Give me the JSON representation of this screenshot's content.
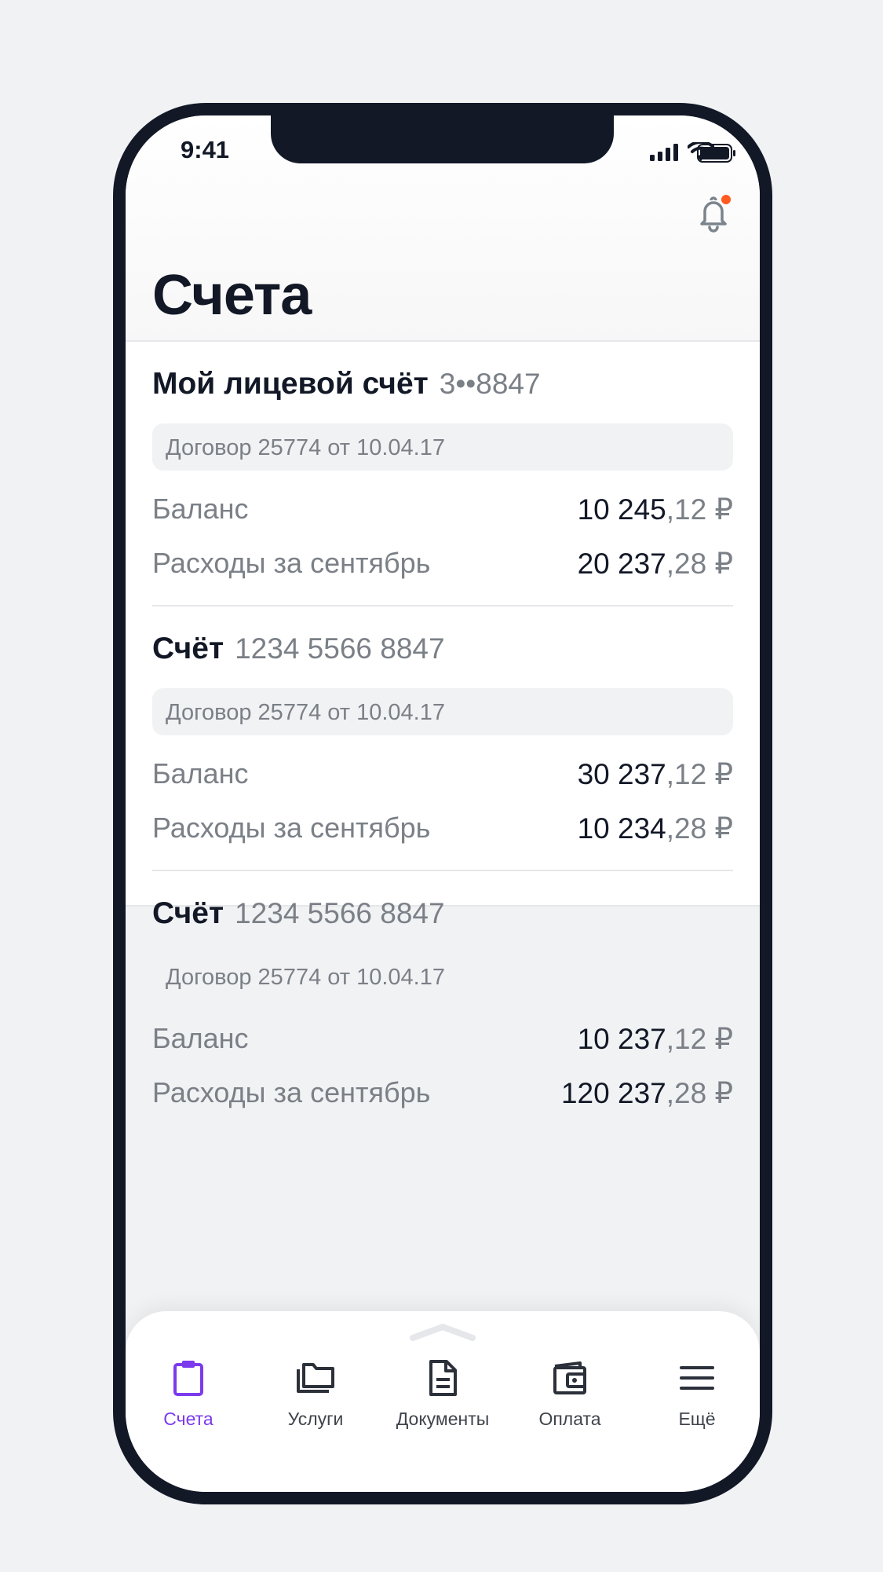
{
  "status_bar": {
    "time": "9:41"
  },
  "header": {
    "title": "Счета"
  },
  "accounts": [
    {
      "name": "Мой лицевой счёт",
      "number": "3••8847",
      "contract": "Договор 25774 от 10.04.17",
      "balance_label": "Баланс",
      "balance_int": "10 245",
      "balance_frac": ",12 ₽",
      "expenses_label": "Расходы за сентябрь",
      "expenses_int": "20 237",
      "expenses_frac": ",28 ₽"
    },
    {
      "name": "Счёт",
      "number": "1234 5566 8847",
      "contract": "Договор 25774 от 10.04.17",
      "balance_label": "Баланс",
      "balance_int": "30 237",
      "balance_frac": ",12 ₽",
      "expenses_label": "Расходы за сентябрь",
      "expenses_int": "10 234",
      "expenses_frac": ",28 ₽"
    },
    {
      "name": "Счёт",
      "number": "1234 5566 8847",
      "contract": "Договор 25774 от 10.04.17",
      "balance_label": "Баланс",
      "balance_int": "10 237",
      "balance_frac": ",12 ₽",
      "expenses_label": "Расходы за сентябрь",
      "expenses_int": "120 237",
      "expenses_frac": ",28 ₽"
    }
  ],
  "tabbar": {
    "items": [
      {
        "label": "Счета",
        "icon": "clipboard-icon",
        "active": true
      },
      {
        "label": "Услуги",
        "icon": "folders-icon",
        "active": false
      },
      {
        "label": "Документы",
        "icon": "document-icon",
        "active": false
      },
      {
        "label": "Оплата",
        "icon": "wallet-icon",
        "active": false
      },
      {
        "label": "Ещё",
        "icon": "menu-icon",
        "active": false
      }
    ]
  },
  "colors": {
    "accent": "#7c3aed",
    "notification_dot": "#ff5a1f",
    "text_primary": "#121826",
    "text_secondary": "#7b8087",
    "background": "#f1f2f4"
  }
}
